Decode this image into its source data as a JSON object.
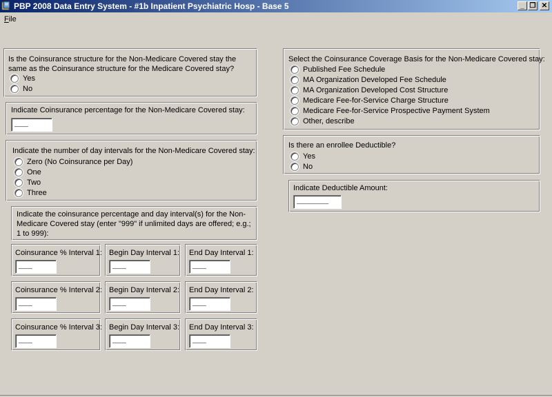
{
  "window": {
    "title": "PBP 2008 Data Entry System - #1b Inpatient Psychiatric Hosp - Base 5",
    "minimize": "_",
    "restore": "❐",
    "close": "✕"
  },
  "menu": {
    "file_underlined": "F",
    "file_rest": "ile"
  },
  "structure_same": {
    "question": "Is the Coinsurance structure for the Non-Medicare Covered stay the same as the Coinsurance structure for the Medicare Covered stay?",
    "options": [
      "Yes",
      "No"
    ]
  },
  "coins_pct": {
    "label": "Indicate Coinsurance percentage for the Non-Medicare Covered stay:",
    "value": "___"
  },
  "day_intervals": {
    "label": "Indicate the number of day intervals for the Non-Medicare Covered stay:",
    "options": [
      "Zero (No Coinsurance per Day)",
      "One",
      "Two",
      "Three"
    ]
  },
  "intervals_instruction": "Indicate the coinsurance percentage and day interval(s) for the Non-Medicare Covered stay (enter \"999\" if unlimited days are offered; e.g.; 1 to 999):",
  "intervals": [
    {
      "pct_label": "Coinsurance % Interval 1:",
      "pct_value": "___",
      "begin_label": "Begin Day Interval 1:",
      "begin_value": "___",
      "end_label": "End Day Interval 1:",
      "end_value": "___"
    },
    {
      "pct_label": "Coinsurance % Interval 2:",
      "pct_value": "___",
      "begin_label": "Begin Day Interval 2:",
      "begin_value": "___",
      "end_label": "End Day Interval 2:",
      "end_value": "___"
    },
    {
      "pct_label": "Coinsurance % Interval 3:",
      "pct_value": "___",
      "begin_label": "Begin Day Interval 3:",
      "begin_value": "___",
      "end_label": "End Day Interval 3:",
      "end_value": "___"
    }
  ],
  "coverage_basis": {
    "label": "Select the Coinsurance Coverage Basis for the Non-Medicare Covered stay:",
    "options": [
      "Published Fee Schedule",
      "MA Organization Developed Fee Schedule",
      "MA Organization Developed Cost Structure",
      "Medicare Fee-for-Service Charge Structure",
      "Medicare Fee-for-Service Prospective Payment System",
      "Other, describe"
    ]
  },
  "deductible": {
    "question": "Is there an enrollee Deductible?",
    "options": [
      "Yes",
      "No"
    ],
    "amount_label": "Indicate Deductible Amount:",
    "amount_value": "_______"
  }
}
